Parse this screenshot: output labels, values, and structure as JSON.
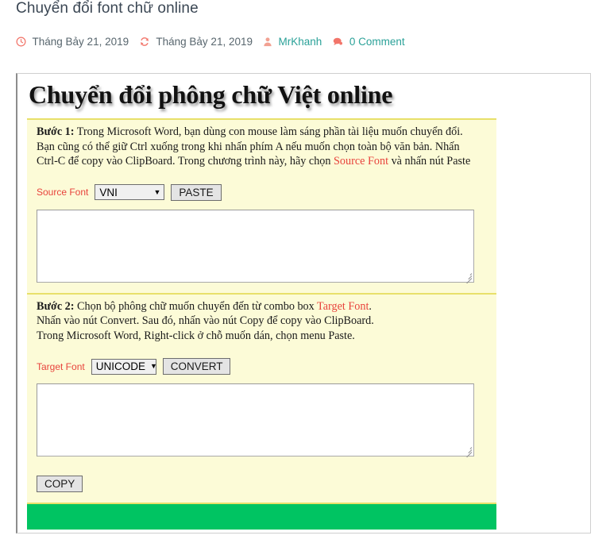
{
  "post": {
    "title": "Chuyển đổi font chữ online",
    "meta": {
      "published_icon": "clock-icon",
      "published_date": "Tháng Bảy 21, 2019",
      "updated_icon": "refresh-icon",
      "updated_date": "Tháng Bảy 21, 2019",
      "author_icon": "user-icon",
      "author": "MrKhanh",
      "comment_icon": "comment-icon",
      "comments": "0 Comment"
    }
  },
  "widget": {
    "banner_title": "Chuyển đổi phông chữ Việt online",
    "step1": {
      "label": "Bước 1:",
      "line1_a": " Trong Microsoft Word, bạn dùng con mouse làm sáng phần tài liệu muốn chuyển đổi.",
      "line2": "Bạn cũng có thể giữ Ctrl xuống trong khi nhấn phím A nếu muốn chọn toàn bộ văn bản. Nhấn",
      "line3_a": "Ctrl-C để copy vào ClipBoard.  Trong chương trình này, hãy chọn ",
      "line3_highlight": "Source Font",
      "line3_b": " và nhấn nút Paste"
    },
    "source_row": {
      "label": "Source Font",
      "select_value": "VNI",
      "select_options": [
        "VNI"
      ],
      "caret": "▼",
      "button": "PASTE"
    },
    "source_textarea": {
      "value": "",
      "placeholder": ""
    },
    "step2": {
      "label": "Bước 2:",
      "line1_a": " Chọn bộ phông chữ muốn chuyển đến từ combo box ",
      "line1_highlight": "Target Font",
      "line1_b": ".",
      "line2": "Nhấn vào nút Convert. Sau đó, nhấn vào nút Copy để copy vào ClipBoard.",
      "line3": "Trong Microsoft Word, Right-click ở chỗ muốn dán, chọn menu Paste."
    },
    "target_row": {
      "label": "Target Font",
      "select_value": "UNICODE",
      "select_options": [
        "UNICODE"
      ],
      "caret": "▼",
      "button": "CONVERT"
    },
    "target_textarea": {
      "value": "",
      "placeholder": ""
    },
    "copy_button": "COPY",
    "status_bar": {
      "text": "",
      "color": "#00c462"
    }
  },
  "colors": {
    "panel_bg": "#fcfbd7",
    "panel_border": "#e8e06a",
    "accent_red": "#e8433c",
    "meta_teal": "#2aa198",
    "meta_icon": "#f2756a",
    "green": "#00c462"
  }
}
